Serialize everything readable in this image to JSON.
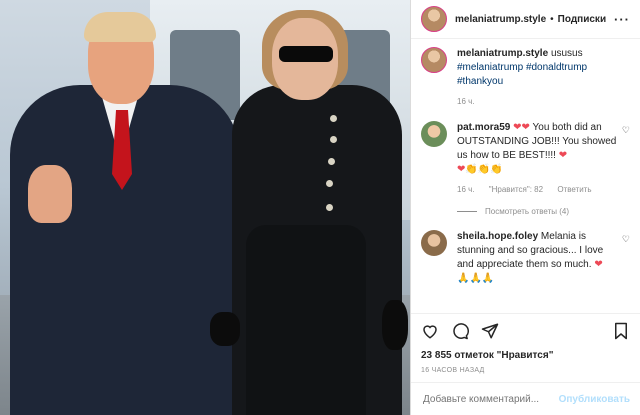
{
  "header": {
    "username": "melaniatrump.style",
    "separator": "•",
    "follow_label": "Подписки",
    "more_icon": "ellipsis-icon"
  },
  "caption": {
    "username": "melaniatrump.style",
    "text": "ususus",
    "hashtags": [
      "#melaniatrump",
      "#donaldtrump",
      "#thankyou"
    ],
    "time": "16 ч."
  },
  "comments": [
    {
      "username": "pat.mora59",
      "text_1": "You both did an OUTSTANDING JOB!!! You showed us how to BE BEST!!!!",
      "time": "16 ч.",
      "likes": "\"Нравится\": 82",
      "reply": "Ответить",
      "view_replies": "Посмотреть ответы (4)"
    },
    {
      "username": "sheila.hope.foley",
      "text_1": "Melania is stunning and so gracious... I love and appreciate them so much."
    }
  ],
  "actions": {
    "likes": "23 855 отметок \"Нравится\"",
    "time": "16 ЧАСОВ НАЗАД"
  },
  "add_comment": {
    "placeholder": "Добавьте комментарий...",
    "publish_label": "Опубликовать"
  },
  "colors": {
    "accent": "#0095f6",
    "publish_disabled": "#b2dffc",
    "heart": "#ed4956"
  }
}
